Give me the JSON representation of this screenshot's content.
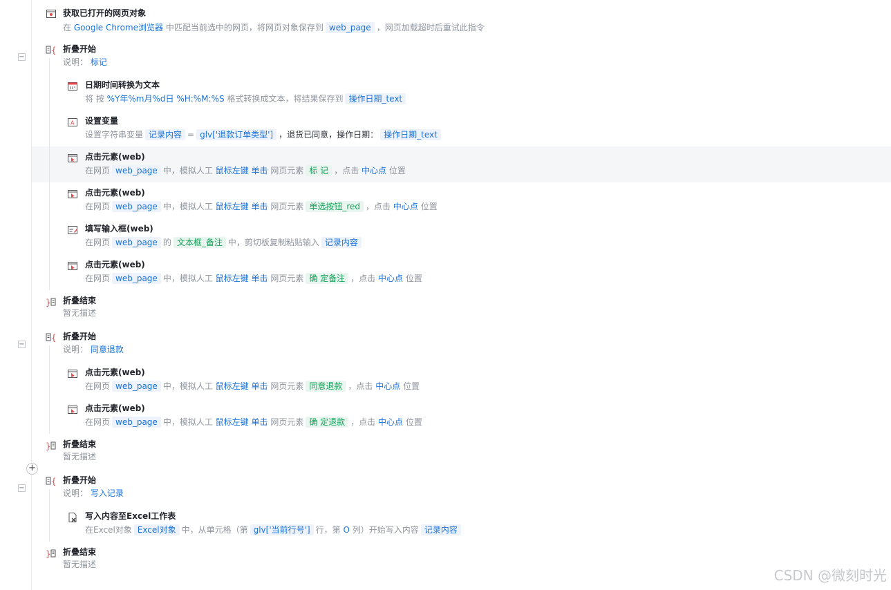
{
  "steps": {
    "s1": {
      "title": "获取已打开的网页对象",
      "p1": "在",
      "browser": "Google Chrome浏览器",
      "p2": "中匹配当前选中的网页，将网页对象保存到",
      "var": "web_page",
      "p3": "，网页加载超时后重试此指令",
      "icon": "browser-window-icon"
    },
    "f1": {
      "title": "折叠开始",
      "label": "说明：",
      "value": "标记",
      "icon": "fold-start-icon"
    },
    "s2": {
      "title": "日期时间转换为文本",
      "p1": "将 按",
      "fmt": "%Y年%m月%d日 %H:%M:%S",
      "p2": "格式转换成文本，将结果保存到",
      "var": "操作日期_text",
      "icon": "calendar-icon"
    },
    "s3": {
      "title": "设置变量",
      "p1": "设置字符串变量",
      "var": "记录内容",
      "eq": "=",
      "expr": "glv['退款订单类型']",
      "p2": "，退货已同意，操作日期：",
      "var2": "操作日期_text",
      "icon": "set-variable-icon"
    },
    "s4": {
      "title": "点击元素(web)",
      "p1": "在网页",
      "page": "web_page",
      "p2": "中，模拟人工",
      "btn": "鼠标左键",
      "act": "单击",
      "p3": "网页元素",
      "el": "标 记",
      "p4": "，点击",
      "pos": "中心点",
      "p5": "位置",
      "icon": "click-element-icon"
    },
    "s5": {
      "title": "点击元素(web)",
      "p1": "在网页",
      "page": "web_page",
      "p2": "中，模拟人工",
      "btn": "鼠标左键",
      "act": "单击",
      "p3": "网页元素",
      "el": "单选按钮_red",
      "p4": "，点击",
      "pos": "中心点",
      "p5": "位置",
      "icon": "click-element-icon"
    },
    "s6": {
      "title": "填写输入框(web)",
      "p1": "在网页",
      "page": "web_page",
      "p2": "的",
      "el": "文本框_备注",
      "p3": "中，剪切板复制粘贴输入",
      "var": "记录内容",
      "icon": "fill-input-icon"
    },
    "s7": {
      "title": "点击元素(web)",
      "p1": "在网页",
      "page": "web_page",
      "p2": "中，模拟人工",
      "btn": "鼠标左键",
      "act": "单击",
      "p3": "网页元素",
      "el": "确 定备注",
      "p4": "，点击",
      "pos": "中心点",
      "p5": "位置",
      "icon": "click-element-icon"
    },
    "e1": {
      "title": "折叠结束",
      "desc": "暂无描述",
      "icon": "fold-end-icon"
    },
    "f2": {
      "title": "折叠开始",
      "label": "说明：",
      "value": "同意退款",
      "icon": "fold-start-icon"
    },
    "s8": {
      "title": "点击元素(web)",
      "p1": "在网页",
      "page": "web_page",
      "p2": "中，模拟人工",
      "btn": "鼠标左键",
      "act": "单击",
      "p3": "网页元素",
      "el": "同意退款",
      "p4": "，点击",
      "pos": "中心点",
      "p5": "位置",
      "icon": "click-element-icon"
    },
    "s9": {
      "title": "点击元素(web)",
      "p1": "在网页",
      "page": "web_page",
      "p2": "中，模拟人工",
      "btn": "鼠标左键",
      "act": "单击",
      "p3": "网页元素",
      "el": "确 定退款",
      "p4": "，点击",
      "pos": "中心点",
      "p5": "位置",
      "icon": "click-element-icon"
    },
    "e2": {
      "title": "折叠结束",
      "desc": "暂无描述",
      "icon": "fold-end-icon"
    },
    "f3": {
      "title": "折叠开始",
      "label": "说明：",
      "value": "写入记录",
      "icon": "fold-start-icon"
    },
    "s10": {
      "title": "写入内容至Excel工作表",
      "p1": "在Excel对象",
      "obj": "Excel对象",
      "p2": "中，从单元格（第",
      "row": "glv['当前行号']",
      "p3": "行，第",
      "col": "O",
      "p4": "列）开始写入内容",
      "var": "记录内容",
      "icon": "excel-icon"
    },
    "e3": {
      "title": "折叠结束",
      "desc": "暂无描述",
      "icon": "fold-end-icon"
    }
  },
  "controls": {
    "collapse": "−",
    "add": "+"
  },
  "watermark": "CSDN @微刻时光",
  "colors": {
    "link": "#1a73d9",
    "chip_bg": "#eef3fb",
    "green": "#14a05a",
    "green_bg": "#e9f6ef",
    "fold_red": "#e5484d",
    "muted": "#8f959e"
  }
}
